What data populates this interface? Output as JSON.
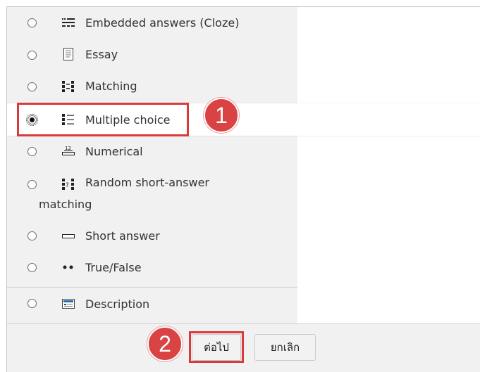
{
  "question_types": [
    {
      "label": "Embedded answers (Cloze)",
      "icon": "cloze-icon",
      "selected": false
    },
    {
      "label": "Essay",
      "icon": "essay-icon",
      "selected": false
    },
    {
      "label": "Matching",
      "icon": "matching-icon",
      "selected": false
    },
    {
      "label": "Multiple choice",
      "icon": "multichoice-icon",
      "selected": true
    },
    {
      "label": "Numerical",
      "icon": "numerical-icon",
      "selected": false
    },
    {
      "label_line1": "Random short-answer",
      "label_line2": "matching",
      "icon": "random-matching-icon",
      "selected": false
    },
    {
      "label": "Short answer",
      "icon": "short-answer-icon",
      "selected": false
    },
    {
      "label": "True/False",
      "icon": "truefalse-icon",
      "selected": false
    }
  ],
  "other_types": [
    {
      "label": "Description",
      "icon": "description-icon",
      "selected": false
    }
  ],
  "buttons": {
    "next_label": "ต่อไป",
    "cancel_label": "ยกเลิก"
  },
  "markers": {
    "step1": "1",
    "step2": "2"
  },
  "colors": {
    "highlight": "#d93a3a",
    "panel_bg": "#f1f1f1"
  }
}
